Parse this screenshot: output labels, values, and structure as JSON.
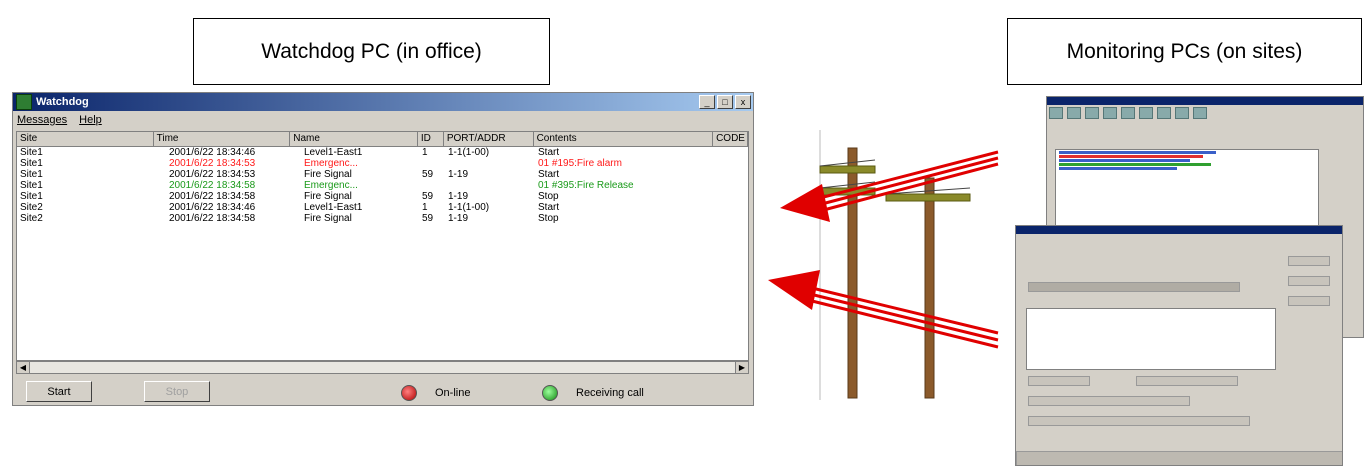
{
  "labels": {
    "watchdog": "Watchdog PC (in office)",
    "monitoring": "Monitoring PCs (on sites)"
  },
  "window": {
    "title": "Watchdog",
    "title_controls": [
      "_",
      "□",
      "x"
    ],
    "menu": [
      "Messages",
      "Help"
    ],
    "columns": [
      "Site",
      "Time",
      "Name",
      "ID",
      "PORT/ADDR",
      "Contents",
      "CODE"
    ],
    "rows": [
      {
        "site": "Site1",
        "time": "2001/6/22 18:34:46",
        "name": "Level1-East1",
        "id": "1",
        "port": "1-1(1-00)",
        "contents": "Start",
        "color": "black"
      },
      {
        "site": "Site1",
        "time": "2001/6/22 18:34:53",
        "name": "Emergenc...",
        "id": "",
        "port": "",
        "contents": "01 #195:Fire alarm",
        "color": "red"
      },
      {
        "site": "Site1",
        "time": "2001/6/22 18:34:53",
        "name": "Fire Signal",
        "id": "59",
        "port": "1-19",
        "contents": "Start",
        "color": "black"
      },
      {
        "site": "Site1",
        "time": "2001/6/22 18:34:58",
        "name": "Emergenc...",
        "id": "",
        "port": "",
        "contents": "01 #395:Fire Release",
        "color": "green"
      },
      {
        "site": "Site1",
        "time": "2001/6/22 18:34:58",
        "name": "Fire Signal",
        "id": "59",
        "port": "1-19",
        "contents": "Stop",
        "color": "black"
      },
      {
        "site": "Site2",
        "time": "2001/6/22 18:34:46",
        "name": "Level1-East1",
        "id": "1",
        "port": "1-1(1-00)",
        "contents": "Start",
        "color": "black"
      },
      {
        "site": "Site2",
        "time": "2001/6/22 18:34:58",
        "name": "Fire Signal",
        "id": "59",
        "port": "1-19",
        "contents": "Stop",
        "color": "black"
      }
    ],
    "buttons": {
      "start": "Start",
      "stop": "Stop"
    },
    "status": {
      "online": "On-line",
      "receiving": "Receiving call"
    }
  },
  "colors": {
    "red_text": "#ff1a1a",
    "green_text": "#1a9a1a",
    "arrow": "#e00000",
    "pole": "#8b5a2b",
    "crossarm": "#8a8a2a"
  }
}
